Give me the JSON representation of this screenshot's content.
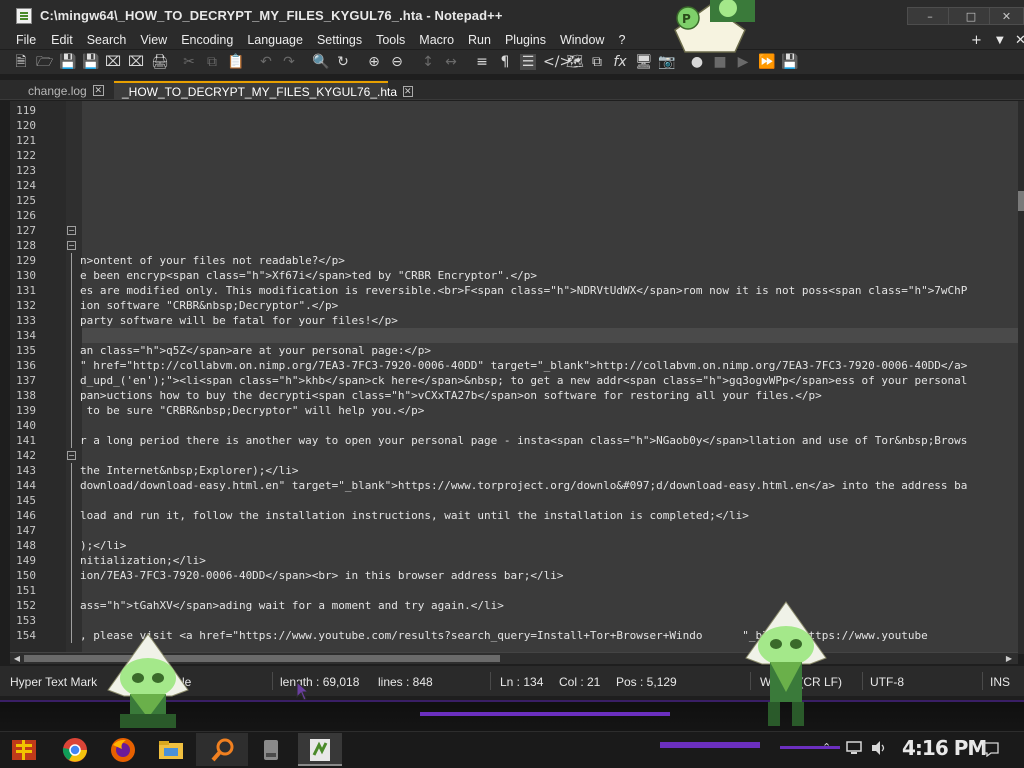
{
  "window": {
    "title": "C:\\mingw64\\_HOW_TO_DECRYPT_MY_FILES_KYGUL76_.hta - Notepad++",
    "minimize": "–",
    "maximize": "□",
    "close": "✕"
  },
  "menu": {
    "items": [
      "File",
      "Edit",
      "Search",
      "View",
      "Encoding",
      "Language",
      "Settings",
      "Tools",
      "Macro",
      "Run",
      "Plugins",
      "Window",
      "?"
    ],
    "plus": "+",
    "dropdown": "▼",
    "close": "✕"
  },
  "tabs": [
    {
      "label": "change.log",
      "active": false
    },
    {
      "label": "_HOW_TO_DECRYPT_MY_FILES_KYGUL76_.hta",
      "active": true
    }
  ],
  "editor": {
    "current_line": 134,
    "lines": [
      {
        "n": "119",
        "text": ""
      },
      {
        "n": "120",
        "text": ""
      },
      {
        "n": "121",
        "text": ""
      },
      {
        "n": "122",
        "text": ""
      },
      {
        "n": "123",
        "text": ""
      },
      {
        "n": "124",
        "text": ""
      },
      {
        "n": "125",
        "text": ""
      },
      {
        "n": "126",
        "text": ""
      },
      {
        "n": "127",
        "text": ""
      },
      {
        "n": "128",
        "text": ""
      },
      {
        "n": "129",
        "text": "n>ontent of your files not readable?</p>"
      },
      {
        "n": "130",
        "text": "e been encryp<span class=\"h\">Xf67i</span>ted by \"CRBR Encryptor\".</p>"
      },
      {
        "n": "131",
        "text": "es are modified only. This modification is reversible.<br>F<span class=\"h\">NDRVtUdWX</span>rom now it is not poss<span class=\"h\">7wChP"
      },
      {
        "n": "132",
        "text": "ion software \"CRBR&nbsp;Decryptor\".</p>"
      },
      {
        "n": "133",
        "text": "party software will be fatal for your files!</p>"
      },
      {
        "n": "134",
        "text": ""
      },
      {
        "n": "135",
        "text": "an class=\"h\">q5Z</span>are at your personal page:</p>"
      },
      {
        "n": "136",
        "text": "\" href=\"http://collabvm.on.nimp.org/7EA3-7FC3-7920-0006-40DD\" target=\"_blank\">http://collabvm.on.nimp.org/7EA3-7FC3-7920-0006-40DD</a>"
      },
      {
        "n": "137",
        "text": "d_upd_('en');\"><li<span class=\"h\">khb</span>ck here</span>&nbsp; to get a new addr<span class=\"h\">gq3ogvWPp</span>ess of your personal"
      },
      {
        "n": "138",
        "text": "pan>uctions how to buy the decrypti<span class=\"h\">vCXxTA27b</span>on software for restoring all your files.</p>"
      },
      {
        "n": "139",
        "text": " to be sure \"CRBR&nbsp;Decryptor\" will help you.</p>"
      },
      {
        "n": "140",
        "text": ""
      },
      {
        "n": "141",
        "text": "r a long period there is another way to open your personal page - insta<span class=\"h\">NGaob0y</span>llation and use of Tor&nbsp;Brows"
      },
      {
        "n": "142",
        "text": ""
      },
      {
        "n": "143",
        "text": "the Internet&nbsp;Explorer);</li>"
      },
      {
        "n": "144",
        "text": "download/download-easy.html.en\" target=\"_blank\">https://www.torproject.org/downlo&#097;d/download-easy.html.en</a> into the address ba"
      },
      {
        "n": "145",
        "text": ""
      },
      {
        "n": "146",
        "text": "load and run it, follow the installation instructions, wait until the installation is completed;</li>"
      },
      {
        "n": "147",
        "text": ""
      },
      {
        "n": "148",
        "text": ");</li>"
      },
      {
        "n": "149",
        "text": "nitialization;</li>"
      },
      {
        "n": "150",
        "text": "ion/7EA3-7FC3-7920-0006-40DD</span><br> in this browser address bar;</li>"
      },
      {
        "n": "151",
        "text": ""
      },
      {
        "n": "152",
        "text": "ass=\"h\">tGahXV</span>ading wait for a moment and try again.</li>"
      },
      {
        "n": "153",
        "text": ""
      },
      {
        "n": "154",
        "text": ", please visit <a href=\"https://www.youtube.com/results?search_query=Install+Tor+Browser+Windo      \"_blank\">https://www.youtube"
      }
    ]
  },
  "statusbar": {
    "filetype": "Hyper Text Mark",
    "filetype_tail": "le",
    "length": "length : 69,018",
    "lines": "lines : 848",
    "ln": "Ln : 134",
    "col": "Col : 21",
    "pos": "Pos : 5,129",
    "eol_a": "W",
    "eol_b": "s (CR LF)",
    "encoding": "UTF-8",
    "mode": "INS"
  },
  "taskbar": {
    "clock": "4:16 PM"
  },
  "colors": {
    "accent": "#e8a000",
    "purple": "#6b2fbf",
    "link": "#d8a0a0"
  }
}
